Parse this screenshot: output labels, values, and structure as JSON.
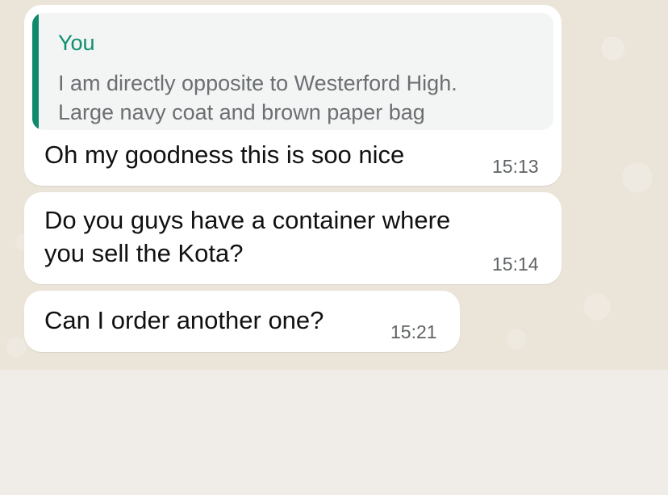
{
  "messages": [
    {
      "quote": {
        "author": "You",
        "line1": "I am directly opposite to Westerford High.",
        "line2": "Large navy coat and brown paper bag"
      },
      "text": "Oh my goodness this is soo nice",
      "time": "15:13"
    },
    {
      "line1": "Do you guys have a container where",
      "line2": "you sell the Kota?",
      "time": "15:14"
    },
    {
      "text": "Can I order another one?",
      "time": "15:21"
    }
  ],
  "colors": {
    "chat_background": "#ebe4d9",
    "bubble": "#ffffff",
    "quote_background": "#f3f4f4",
    "quote_accent": "#0f8a6c",
    "quote_author": "#0c8f6f"
  }
}
